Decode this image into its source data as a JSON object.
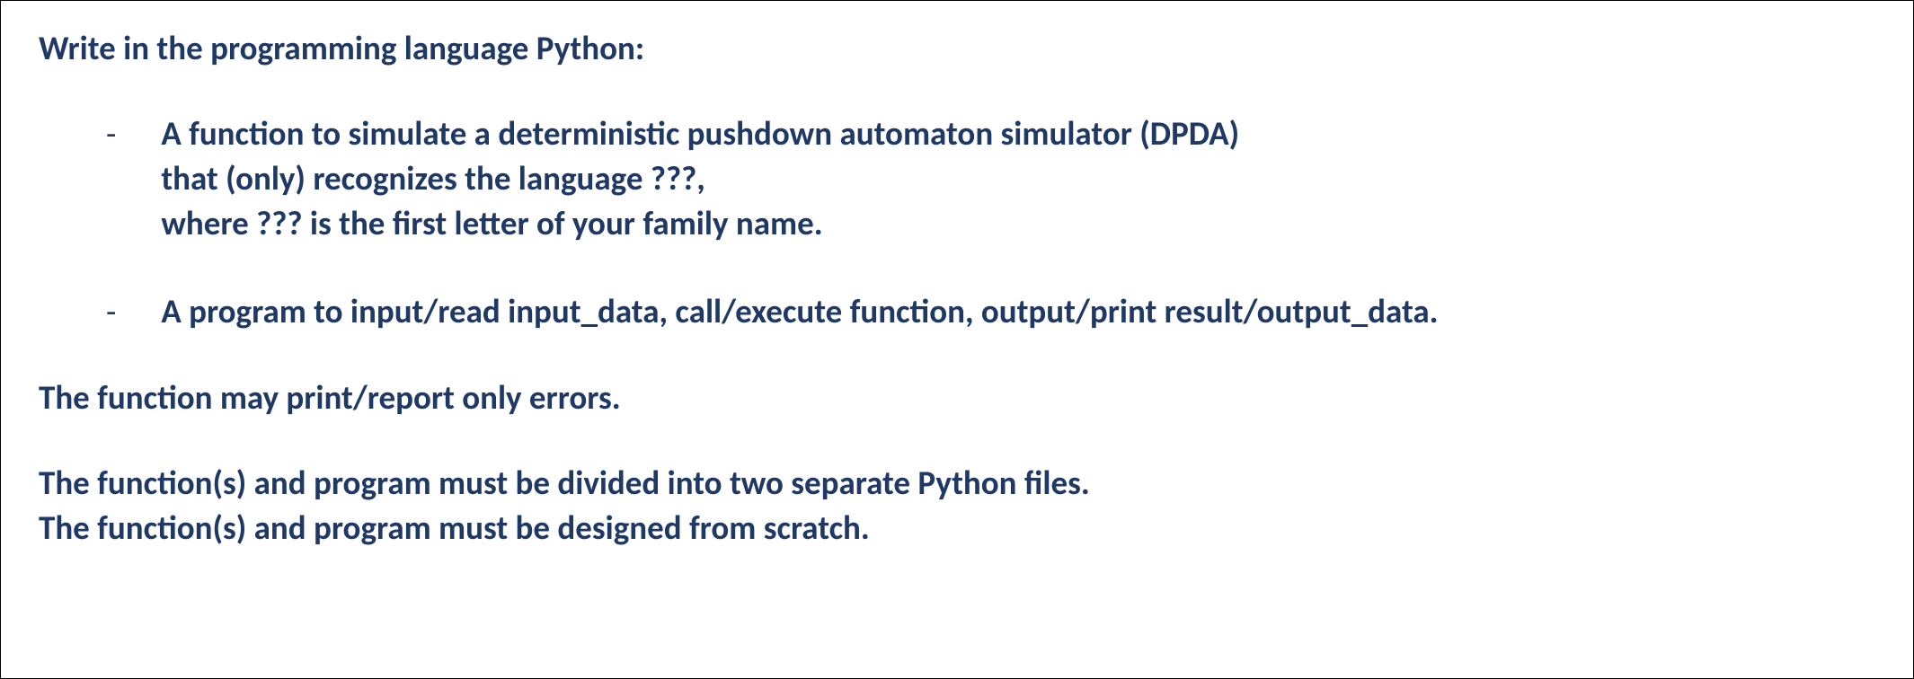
{
  "intro": "Write in the programming language Python:",
  "bullets": [
    {
      "dash": "-",
      "lines": [
        "A function to simulate a deterministic pushdown automaton simulator (DPDA)",
        "that (only) recognizes the language ???,",
        "where ??? is the first letter of your family name."
      ]
    },
    {
      "dash": "-",
      "lines": [
        "A program to input/read input_data, call/execute function, output/print result/output_data."
      ]
    }
  ],
  "note": "The function may print/report only errors.",
  "closing": [
    "The function(s) and program must be divided into two separate Python files.",
    "The function(s) and program must be designed from scratch."
  ]
}
